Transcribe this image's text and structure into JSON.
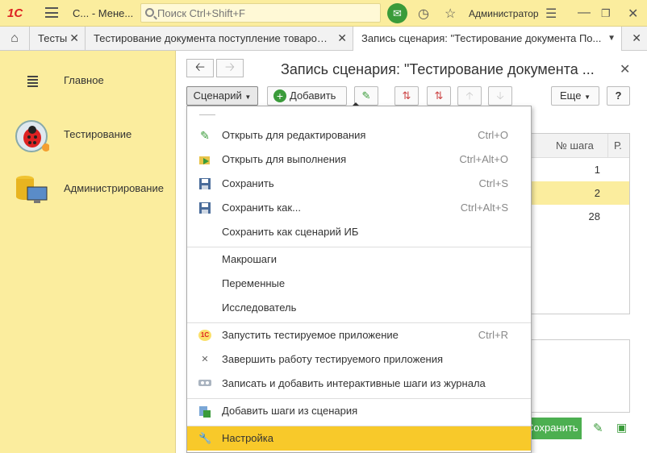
{
  "app": {
    "logo": "1С",
    "title": "С... - Мене...",
    "search_placeholder": "Поиск Ctrl+Shift+F",
    "user": "Администратор"
  },
  "tabs": [
    {
      "label": "Тесты"
    },
    {
      "label": "Тестирование документа поступление товаров и услуг"
    },
    {
      "label": "Запись сценария: \"Тестирование документа По..."
    }
  ],
  "sidebar": {
    "items": [
      {
        "label": "Главное"
      },
      {
        "label": "Тестирование"
      },
      {
        "label": "Администрирование"
      }
    ]
  },
  "window": {
    "title": "Запись сценария: \"Тестирование документа ...",
    "more_label": "Еще",
    "help_label": "?"
  },
  "toolbar": {
    "scenario_label": "Сценарий",
    "add_label": "Добавить"
  },
  "grid": {
    "col_step": "№ шага",
    "col_r": "Р.",
    "rows": [
      "1",
      "2",
      "28"
    ]
  },
  "save_label": "Сохранить",
  "menu": {
    "items": [
      {
        "label": "Открыть для редактирования",
        "shortcut": "Ctrl+O",
        "icon": "pencil-icon"
      },
      {
        "label": "Открыть для выполнения",
        "shortcut": "Ctrl+Alt+O",
        "icon": "open-run-icon"
      },
      {
        "label": "Сохранить",
        "shortcut": "Ctrl+S",
        "icon": "floppy-icon"
      },
      {
        "label": "Сохранить как...",
        "shortcut": "Ctrl+Alt+S",
        "icon": "floppy-icon"
      },
      {
        "label": "Сохранить как сценарий ИБ",
        "shortcut": "",
        "icon": ""
      },
      {
        "label": "Макрошаги",
        "shortcut": "",
        "icon": ""
      },
      {
        "label": "Переменные",
        "shortcut": "",
        "icon": ""
      },
      {
        "label": "Исследователь",
        "shortcut": "",
        "icon": ""
      },
      {
        "label": "Запустить тестируемое приложение",
        "shortcut": "Ctrl+R",
        "icon": "1c-app-icon"
      },
      {
        "label": "Завершить работу тестируемого приложения",
        "shortcut": "",
        "icon": "close-icon"
      },
      {
        "label": "Записать и добавить интерактивные шаги из журнала",
        "shortcut": "",
        "icon": "journal-icon"
      },
      {
        "label": "Добавить шаги из сценария",
        "shortcut": "",
        "icon": "add-steps-icon"
      },
      {
        "label": "Настройка",
        "shortcut": "",
        "icon": "wrench-icon"
      }
    ]
  },
  "colors": {
    "accent": "#fbed9e",
    "highlight": "#f8c92a",
    "green": "#4caf50"
  }
}
